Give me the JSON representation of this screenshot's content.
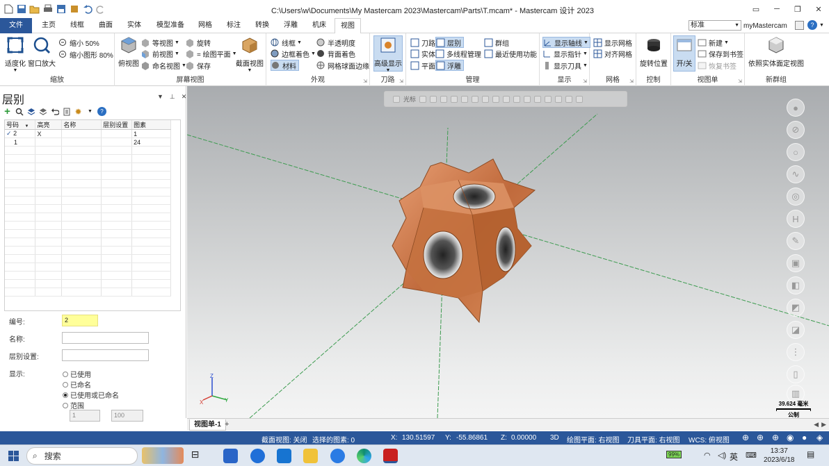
{
  "window": {
    "title": "C:\\Users\\w\\Documents\\My Mastercam 2023\\Mastercam\\Parts\\T.mcam* - Mastercam 设计 2023"
  },
  "tabs": [
    "文件",
    "主页",
    "线框",
    "曲面",
    "实体",
    "模型准备",
    "网格",
    "标注",
    "转换",
    "浮雕",
    "机床",
    "视图"
  ],
  "right_header": {
    "combo": "标准",
    "my": "myMastercam"
  },
  "ribbon": {
    "zoom": {
      "label": "缩放",
      "fit": "适度化",
      "window": "窗口放大",
      "shrink50": "缩小 50%",
      "shrink80": "缩小图形 80%"
    },
    "screen": {
      "label": "屏幕视图",
      "top": "俯视图",
      "iso": "等视图",
      "front": "前视图",
      "named": "命名视图",
      "rotate": "旋转",
      "cplane": "= 绘图平面",
      "save": "保存",
      "section": "截面视图"
    },
    "appearance": {
      "label": "外观",
      "wireframe": "线框",
      "edge_shade": "边框着色",
      "material": "材料",
      "translucent": "半透明度",
      "back_shade": "背面着色",
      "mesh_edges": "网格球面边缘"
    },
    "toolpath": {
      "label": "刀路",
      "advanced": "高级显示"
    },
    "manage": {
      "label": "管理",
      "toolpath": "刀路",
      "solids": "实体",
      "planes": "平面",
      "levels": "层别",
      "multithread": "多线程管理",
      "relief": "浮雕",
      "groups": "群组",
      "recent": "最近使用功能"
    },
    "display": {
      "label": "显示",
      "axes": "显示轴线",
      "pointer": "显示指针",
      "tool": "显示刀具"
    },
    "grid": {
      "label": "网格",
      "show": "显示网格",
      "align": "对齐网格"
    },
    "control": {
      "label": "控制",
      "rotate_pos": "旋转位置"
    },
    "viewsheet": {
      "label": "视图单",
      "toggle": "开/关",
      "new": "新建",
      "save_bm": "保存到书签",
      "restore_bm": "恢复书签"
    },
    "newgroup": {
      "label": "新群组",
      "by_solid": "依照实体面定视图"
    }
  },
  "levels": {
    "title": "层别",
    "columns": [
      "号码",
      "高亮",
      "名称",
      "层别设置",
      "图素"
    ],
    "rows": [
      {
        "num": "2",
        "hl": "X",
        "name": "",
        "set": "",
        "count": "1",
        "checked": true
      },
      {
        "num": "1",
        "hl": "",
        "name": "",
        "set": "",
        "count": "24",
        "checked": false
      }
    ],
    "number_label": "编号:",
    "number_value": "2",
    "name_label": "名称:",
    "set_label": "层别设置:",
    "show_label": "显示:",
    "options": [
      "已使用",
      "已命名",
      "已使用或已命名",
      "范围"
    ],
    "selected_option": 2,
    "range_from": "1",
    "range_to": "100"
  },
  "viewport": {
    "toolbar_label": "光标",
    "scale_value": "39.624 毫米",
    "scale_unit": "公制",
    "axis_x": "X",
    "axis_y": "Y",
    "axis_z": "Z"
  },
  "viewsheet_tab": "视图单-1",
  "status": {
    "section": "截面视图: 关闭",
    "selected": "选择的图素: 0",
    "x_label": "X:",
    "x": "130.51597",
    "y_label": "Y:",
    "y": "-55.86861",
    "z_label": "Z:",
    "z": "0.00000",
    "mode": "3D",
    "cplane": "绘图平面: 右视图",
    "tplane": "刀具平面: 右视图",
    "wcs": "WCS: 俯视图"
  },
  "taskbar": {
    "search": "搜索",
    "battery": "99%",
    "ime": "英",
    "time": "13:37",
    "date": "2023/6/18"
  },
  "colors": {
    "accent": "#2b579a",
    "part": "#c8774a"
  }
}
